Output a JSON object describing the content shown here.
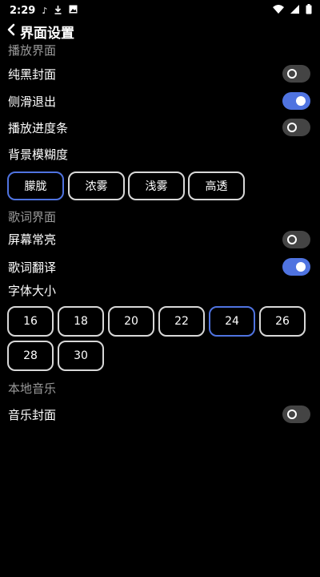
{
  "status": {
    "time": "2:29"
  },
  "header": {
    "title": "界面设置"
  },
  "playback": {
    "section": "播放界面",
    "pure_black_cover": {
      "label": "纯黑封面",
      "on": false
    },
    "swipe_exit": {
      "label": "侧滑退出",
      "on": true
    },
    "progress_bar": {
      "label": "播放进度条",
      "on": false
    },
    "blur_label": "背景模糊度",
    "blur_options": [
      "朦胧",
      "浓雾",
      "浅雾",
      "高透"
    ],
    "blur_selected": "朦胧"
  },
  "lyrics": {
    "section": "歌词界面",
    "screen_on": {
      "label": "屏幕常亮",
      "on": false
    },
    "translate": {
      "label": "歌词翻译",
      "on": true
    },
    "font_size_label": "字体大小",
    "font_sizes": [
      "16",
      "18",
      "20",
      "22",
      "24",
      "26",
      "28",
      "30"
    ],
    "font_selected": "24"
  },
  "local": {
    "section": "本地音乐",
    "music_cover": {
      "label": "音乐封面",
      "on": false
    }
  },
  "colors": {
    "accent": "#4f73e0",
    "toggle_off": "#444444",
    "background": "#000000",
    "section_text": "#9a9a9a"
  }
}
